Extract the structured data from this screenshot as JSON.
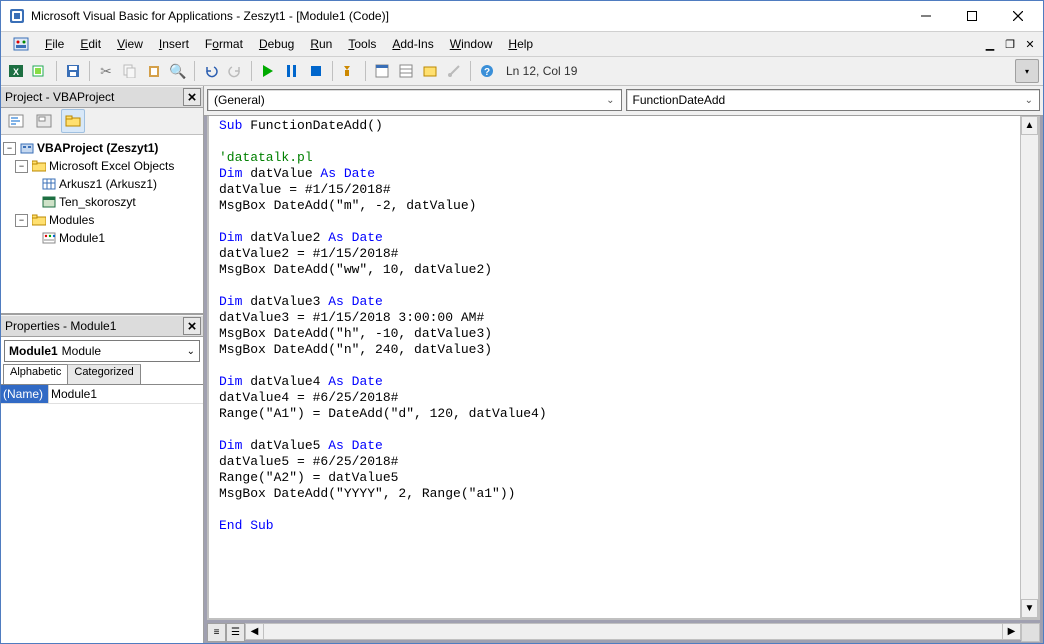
{
  "titlebar": {
    "title": "Microsoft Visual Basic for Applications - Zeszyt1 - [Module1 (Code)]"
  },
  "menu": {
    "file": "File",
    "edit": "Edit",
    "view": "View",
    "insert": "Insert",
    "format": "Format",
    "debug": "Debug",
    "run": "Run",
    "tools": "Tools",
    "addins": "Add-Ins",
    "window": "Window",
    "help": "Help"
  },
  "toolbar": {
    "status": "Ln 12, Col 19"
  },
  "projectPanel": {
    "title": "Project - VBAProject",
    "root": "VBAProject (Zeszyt1)",
    "excelObjects": "Microsoft Excel Objects",
    "sheet1": "Arkusz1 (Arkusz1)",
    "thisWorkbook": "Ten_skoroszyt",
    "modulesFolder": "Modules",
    "module1": "Module1"
  },
  "propsPanel": {
    "title": "Properties - Module1",
    "comboName": "Module1",
    "comboType": "Module",
    "tabAlpha": "Alphabetic",
    "tabCat": "Categorized",
    "row1k": "(Name)",
    "row1v": "Module1"
  },
  "editor": {
    "objCombo": "(General)",
    "procCombo": "FunctionDateAdd"
  },
  "code": {
    "l1a": "Sub",
    "l1b": " FunctionDateAdd()",
    "l3": "'datatalk.pl",
    "l4a": "Dim",
    "l4b": " datValue ",
    "l4c": "As Date",
    "l5": "datValue = #1/15/2018#",
    "l6": "MsgBox DateAdd(\"m\", -2, datValue)",
    "l8a": "Dim",
    "l8b": " datValue2 ",
    "l8c": "As Date",
    "l9": "datValue2 = #1/15/2018#",
    "l10": "MsgBox DateAdd(\"ww\", 10, datValue2)",
    "l12a": "Dim",
    "l12b": " datValue3 ",
    "l12c": "As Date",
    "l13": "datValue3 = #1/15/2018 3:00:00 AM#",
    "l14": "MsgBox DateAdd(\"h\", -10, datValue3)",
    "l15": "MsgBox DateAdd(\"n\", 240, datValue3)",
    "l17a": "Dim",
    "l17b": " datValue4 ",
    "l17c": "As Date",
    "l18": "datValue4 = #6/25/2018#",
    "l19": "Range(\"A1\") = DateAdd(\"d\", 120, datValue4)",
    "l21a": "Dim",
    "l21b": " datValue5 ",
    "l21c": "As Date",
    "l22": "datValue5 = #6/25/2018#",
    "l23": "Range(\"A2\") = datValue5",
    "l24": "MsgBox DateAdd(\"YYYY\", 2, Range(\"a1\"))",
    "l26": "End Sub"
  }
}
